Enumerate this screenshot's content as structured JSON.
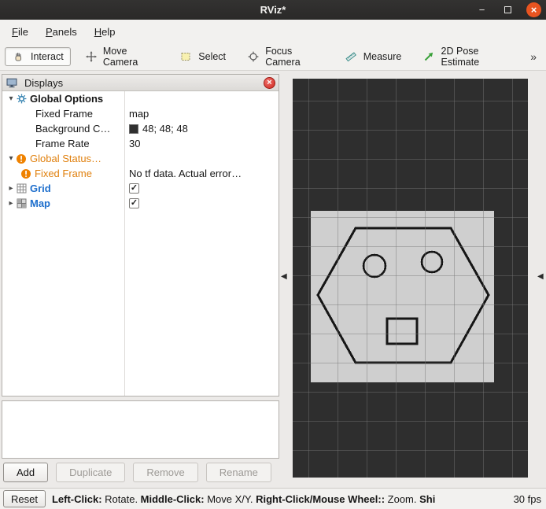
{
  "window": {
    "title": "RViz*"
  },
  "menubar": {
    "items": [
      {
        "label": "File"
      },
      {
        "label": "Panels"
      },
      {
        "label": "Help"
      }
    ]
  },
  "toolbar": {
    "tools": [
      {
        "label": "Interact"
      },
      {
        "label": "Move Camera"
      },
      {
        "label": "Select"
      },
      {
        "label": "Focus Camera"
      },
      {
        "label": "Measure"
      },
      {
        "label": "2D Pose Estimate"
      }
    ]
  },
  "displays": {
    "title": "Displays",
    "rows": [
      {
        "label": "Global Options",
        "value": ""
      },
      {
        "label": "Fixed Frame",
        "value": "map"
      },
      {
        "label": "Background C…",
        "value": "48; 48; 48"
      },
      {
        "label": "Frame Rate",
        "value": "30"
      },
      {
        "label": "Global Status…",
        "value": ""
      },
      {
        "label": "Fixed Frame",
        "value": "No tf data.  Actual error…"
      },
      {
        "label": "Grid",
        "value": ""
      },
      {
        "label": "Map",
        "value": ""
      }
    ],
    "buttons": {
      "add": "Add",
      "duplicate": "Duplicate",
      "remove": "Remove",
      "rename": "Rename"
    }
  },
  "viewport": {
    "background_rgb": "48; 48; 48"
  },
  "statusbar": {
    "reset": "Reset",
    "segments": [
      {
        "text": "Left-Click:"
      },
      {
        "text": " Rotate. "
      },
      {
        "text": "Middle-Click:"
      },
      {
        "text": " Move X/Y. "
      },
      {
        "text": "Right-Click/Mouse Wheel::"
      },
      {
        "text": " Zoom. "
      },
      {
        "text": "Shi"
      }
    ],
    "fps": "30 fps"
  },
  "colors": {
    "warning_orange": "#e0800e",
    "display_blue": "#1d6ecc",
    "viewport_bg": "#303030",
    "close_button": "#e95420"
  }
}
